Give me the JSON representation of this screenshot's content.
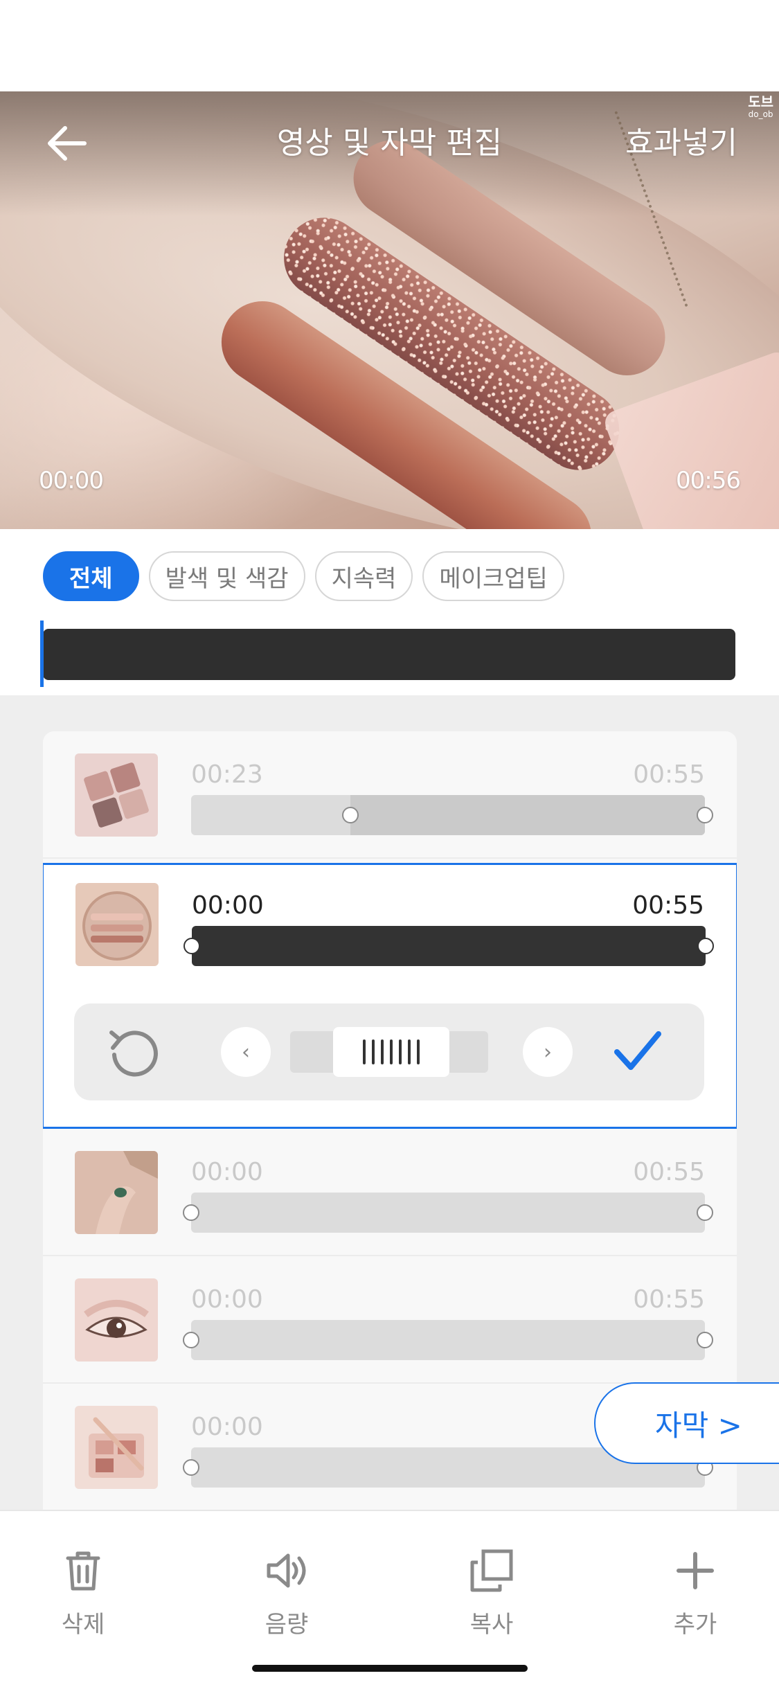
{
  "header": {
    "title": "영상 및 자막 편집",
    "action_label": "효과넣기",
    "watermark_main": "도브",
    "watermark_sub": "do_ob"
  },
  "video": {
    "time_start": "00:00",
    "time_end": "00:56"
  },
  "categories": [
    {
      "label": "전체",
      "active": true
    },
    {
      "label": "발색 및 색감",
      "active": false
    },
    {
      "label": "지속력",
      "active": false
    },
    {
      "label": "메이크업팁",
      "active": false
    }
  ],
  "clips": [
    {
      "start": "00:23",
      "end": "00:55",
      "selected": false,
      "range_start_fraction": 0.31
    },
    {
      "start": "00:00",
      "end": "00:55",
      "selected": true
    },
    {
      "start": "00:00",
      "end": "00:55",
      "selected": false
    },
    {
      "start": "00:00",
      "end": "00:55",
      "selected": false
    },
    {
      "start": "00:00",
      "end": "",
      "selected": false
    }
  ],
  "subtitle_button": {
    "label": "자막 >"
  },
  "toolbar": {
    "delete_label": "삭제",
    "volume_label": "음량",
    "copy_label": "복사",
    "add_label": "추가"
  },
  "colors": {
    "accent": "#1a73e8",
    "track_dark": "#333333",
    "track_light": "#dcdcdc"
  }
}
